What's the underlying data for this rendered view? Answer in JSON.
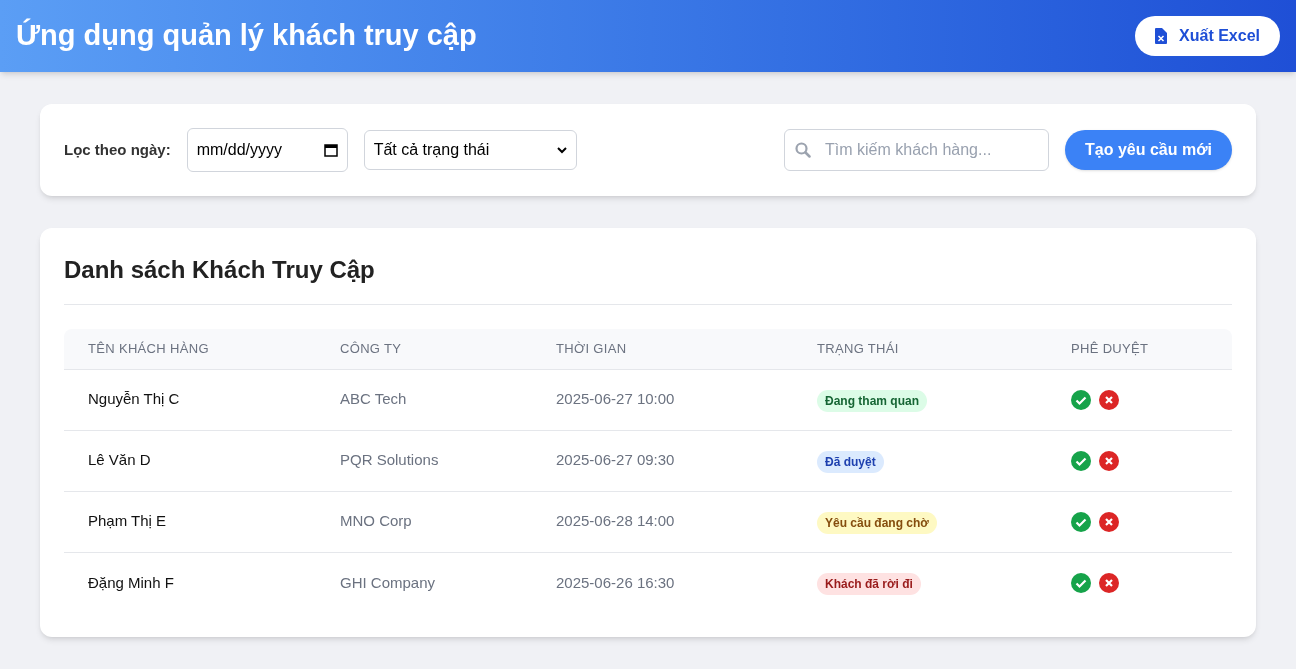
{
  "header": {
    "title": "Ứng dụng quản lý khách truy cập",
    "export_button": "Xuất Excel"
  },
  "filters": {
    "date_label": "Lọc theo ngày:",
    "date_field": {
      "placeholder": "mm/dd/yyyy"
    },
    "status_select": {
      "value": "Tất cả trạng thái"
    },
    "search": {
      "placeholder": "Tìm kiếm khách hàng..."
    },
    "new_request_button": "Tạo yêu cầu mới"
  },
  "table": {
    "title": "Danh sách Khách Truy Cập",
    "columns": [
      "TÊN KHÁCH HÀNG",
      "CÔNG TY",
      "THỜI GIAN",
      "TRẠNG THÁI",
      "PHÊ DUYỆT"
    ],
    "rows": [
      {
        "name": "Nguyễn Thị C",
        "company": "ABC Tech",
        "time": "2025-06-27 10:00",
        "status": {
          "label": "Đang tham quan",
          "kind": "visiting"
        }
      },
      {
        "name": "Lê Văn D",
        "company": "PQR Solutions",
        "time": "2025-06-27 09:30",
        "status": {
          "label": "Đã duyệt",
          "kind": "approved"
        }
      },
      {
        "name": "Phạm Thị E",
        "company": "MNO Corp",
        "time": "2025-06-28 14:00",
        "status": {
          "label": "Yêu cầu đang chờ",
          "kind": "pending"
        }
      },
      {
        "name": "Đặng Minh F",
        "company": "GHI Company",
        "time": "2025-06-26 16:30",
        "status": {
          "label": "Khách đã rời đi",
          "kind": "left"
        }
      }
    ]
  }
}
